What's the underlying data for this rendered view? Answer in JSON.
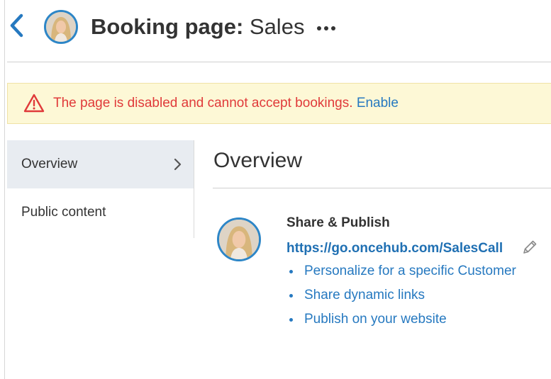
{
  "header": {
    "title_bold": "Booking page:",
    "title_name": " Sales"
  },
  "alert": {
    "message": "The page is disabled and cannot accept bookings.",
    "action": "Enable"
  },
  "sidebar": {
    "items": [
      {
        "label": "Overview",
        "active": true
      },
      {
        "label": "Public content",
        "active": false
      }
    ]
  },
  "main": {
    "title": "Overview",
    "share": {
      "heading": "Share & Publish",
      "url": "https://go.oncehub.com/SalesCall",
      "links": [
        "Personalize for a specific Customer",
        "Share dynamic links",
        "Publish on your website"
      ]
    }
  },
  "colors": {
    "accent": "#2679c0",
    "alert_text": "#e03a3a",
    "alert_bg": "#fdf8d6",
    "avatar_ring": "#2d86c7"
  },
  "icons": {
    "back": "chevron-left-icon",
    "more": "more-horizontal-icon",
    "warning": "warning-triangle-icon",
    "sidebar_chevron": "chevron-right-icon",
    "edit": "pencil-icon"
  }
}
